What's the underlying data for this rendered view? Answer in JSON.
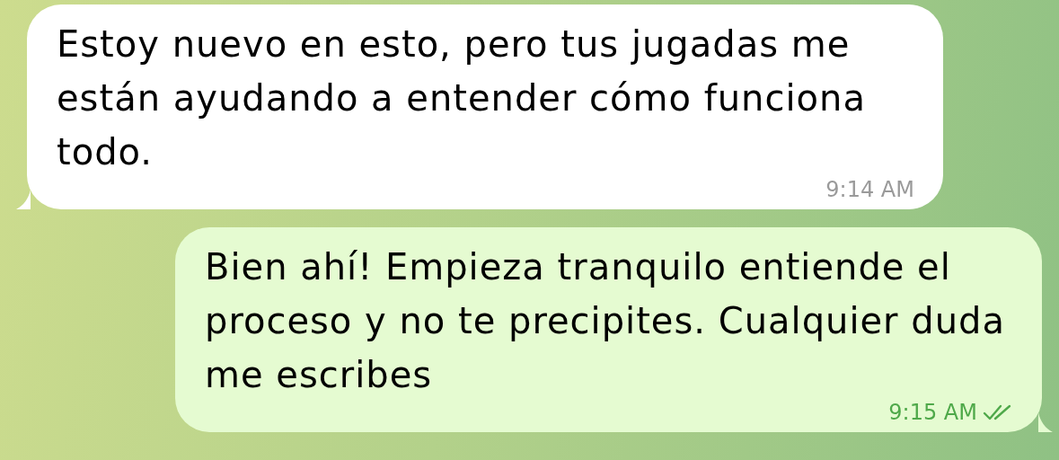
{
  "messages": [
    {
      "outgoing": false,
      "text": "Estoy nuevo en esto, pero tus jugadas me están ayudando a entender cómo funciona todo.",
      "time": "9:14 AM"
    },
    {
      "outgoing": true,
      "text": "Bien ahí! Empieza tranquilo entiende el proceso y no te precipites. Cualquier duda me escribes",
      "time": "9:15 AM",
      "read": true
    }
  ]
}
